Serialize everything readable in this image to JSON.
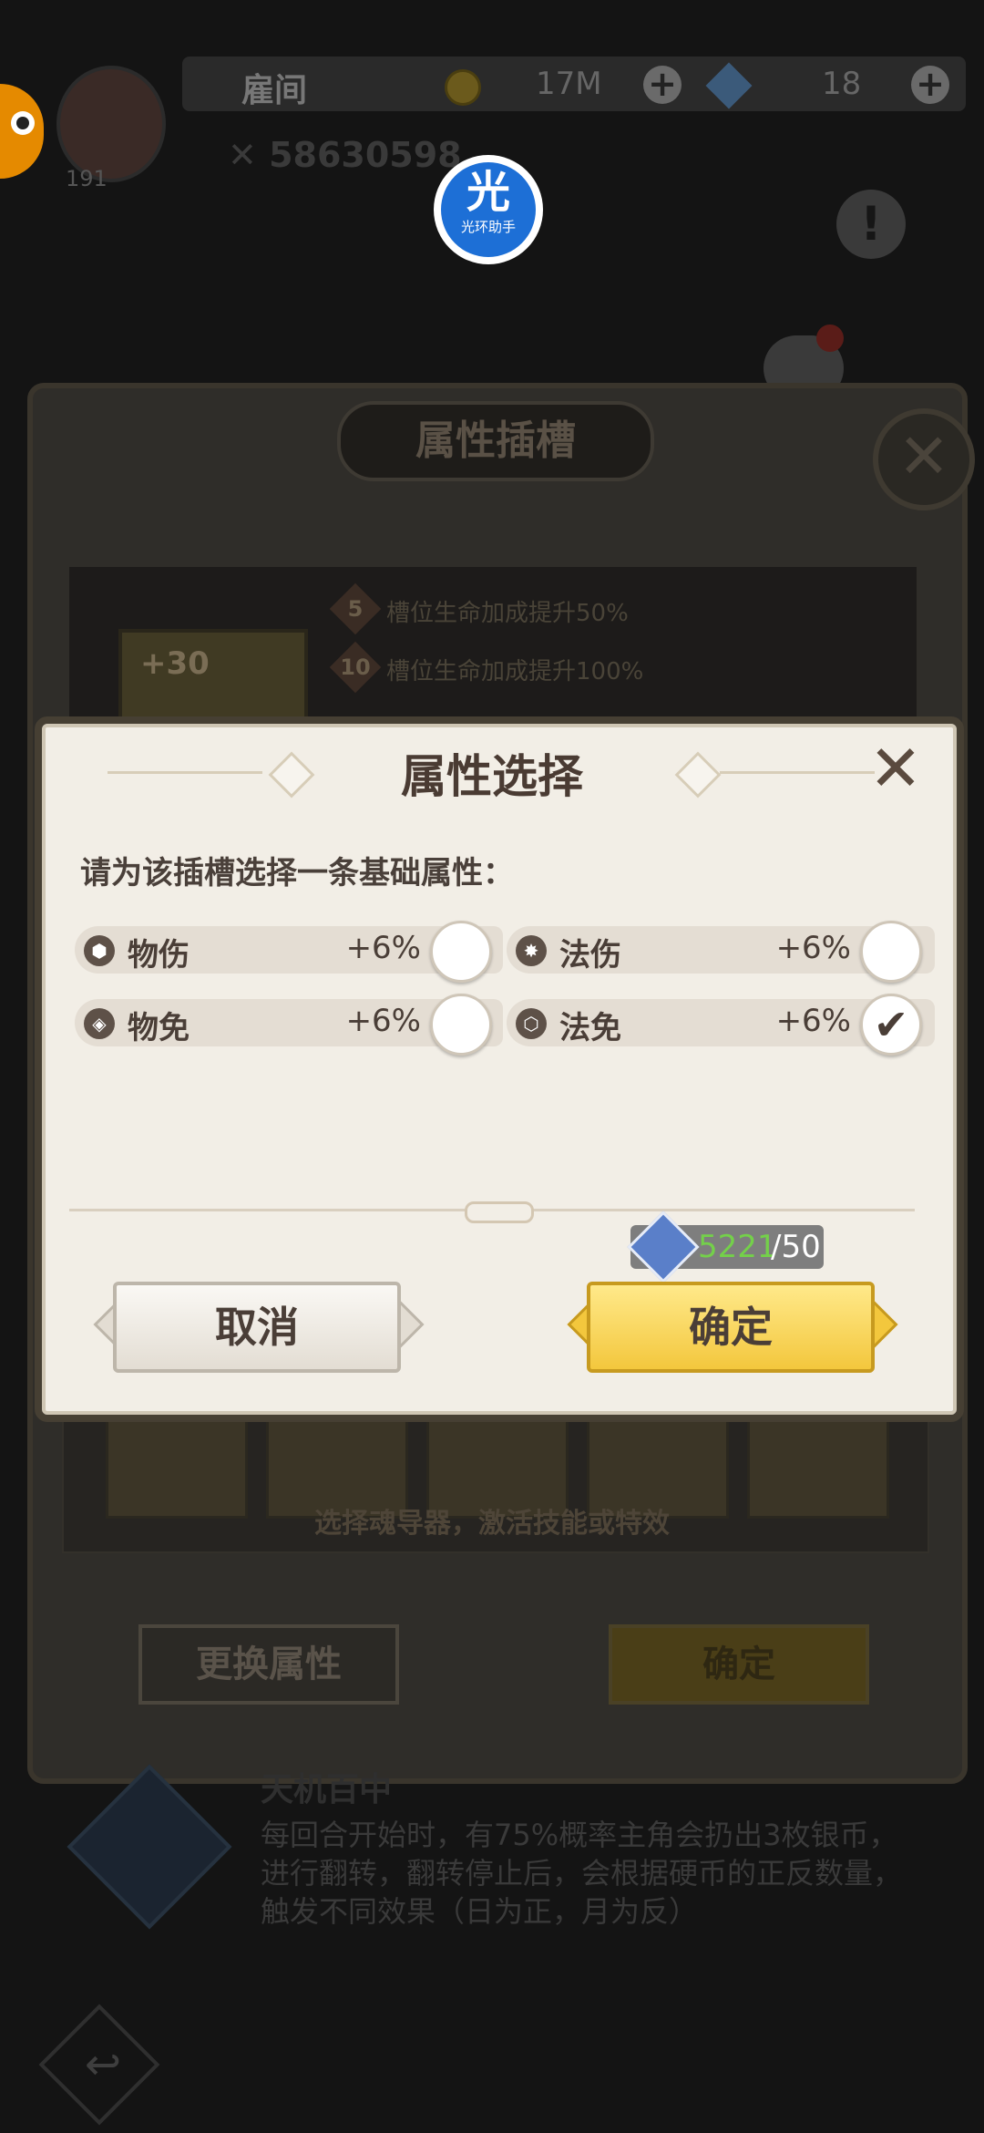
{
  "hud": {
    "player_name": "雇间",
    "gold": "17M",
    "diamonds": "18",
    "level": "191",
    "power": "58630598"
  },
  "helper": {
    "glyph": "光",
    "label": "光环助手"
  },
  "background": {
    "title": "属性插槽",
    "slot_plus": "+30",
    "bonus_lines": [
      {
        "level": "5",
        "text": "槽位生命加成提升50%"
      },
      {
        "level": "10",
        "text": "槽位生命加成提升100%"
      }
    ],
    "hint": "选择魂导器，激活技能或特效",
    "swap_button": "更换属性",
    "confirm_button": "确定",
    "skill_title": "天机百中",
    "skill_desc": "每回合开始时，有75%概率主角会扔出3枚银币，进行翻转，翻转停止后，会根据硬币的正反数量，触发不同效果（日为正，月为反）"
  },
  "dialog": {
    "title": "属性选择",
    "prompt": "请为该插槽选择一条基础属性：",
    "options": [
      {
        "label": "物伤",
        "value": "+6%",
        "selected": false
      },
      {
        "label": "法伤",
        "value": "+6%",
        "selected": false
      },
      {
        "label": "物免",
        "value": "+6%",
        "selected": false
      },
      {
        "label": "法免",
        "value": "+6%",
        "selected": true
      }
    ],
    "check_mark": "✔",
    "resource": {
      "have": "5221",
      "need": "/50"
    },
    "cancel": "取消",
    "confirm": "确定"
  },
  "icons": {
    "close": "✕",
    "warn": "!",
    "back": "↩"
  },
  "colors": {
    "dialog_bg": "#f2eee6",
    "confirm_yellow": "#f3c73d",
    "resource_green": "#74d04a"
  }
}
